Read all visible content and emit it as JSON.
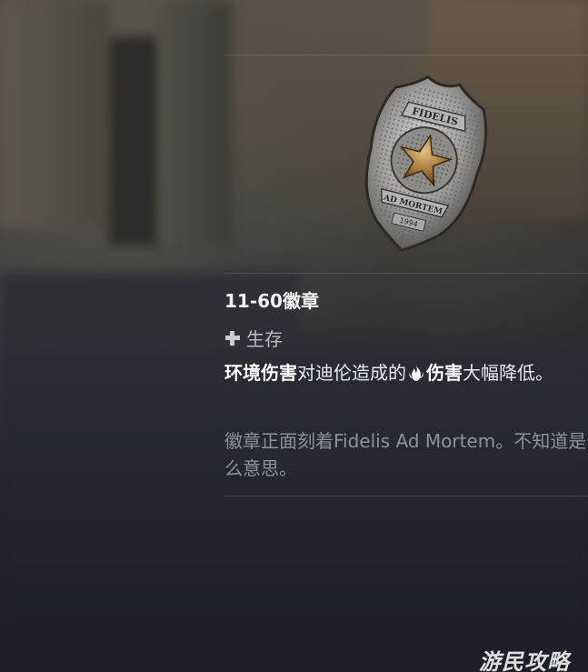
{
  "item": {
    "title": "11-60徽章",
    "category": "生存",
    "effect": {
      "term1": "环境伤害",
      "middle": "对迪伦造成的",
      "term2": "伤害",
      "tail": "大幅降低。"
    },
    "flavor": "徽章正面刻着Fidelis Ad Mortem。不知道是什么意思。"
  },
  "badge": {
    "engraving_top": "FIDELIS",
    "engraving_bottom": "AD MORTEM",
    "year": "1994"
  },
  "icons": {
    "category": "plus-icon",
    "damage_type": "fire-icon"
  },
  "watermark": "游民攻略",
  "colors": {
    "title": "#f2f2f2",
    "body": "#e8e8ea",
    "muted": "#8d9199",
    "divider": "rgba(255,255,255,0.12)"
  }
}
